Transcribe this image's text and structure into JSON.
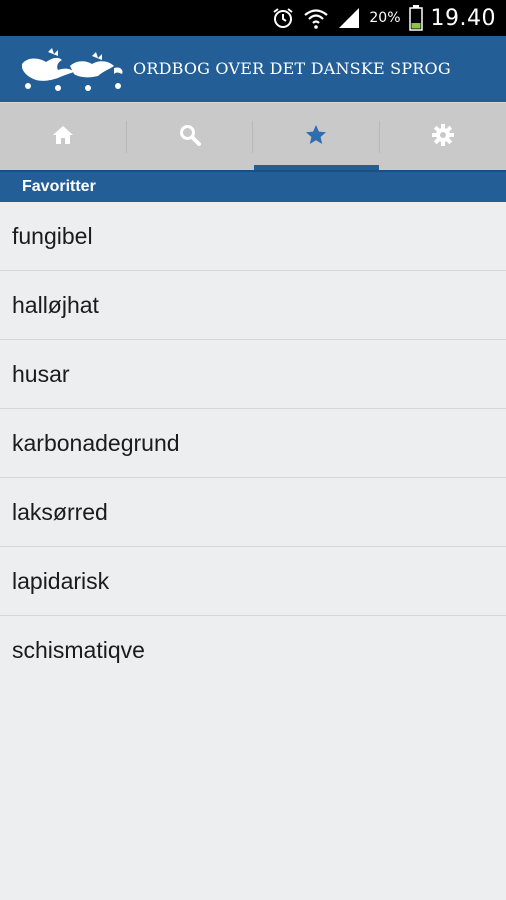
{
  "statusbar": {
    "battery_percent": "20%",
    "time": "19.40",
    "icons": [
      "alarm-icon",
      "wifi-icon",
      "signal-icon",
      "battery-icon"
    ]
  },
  "header": {
    "title": "ORDBOG OVER DET DANSKE SPROG",
    "logo": "danish-lions-logo",
    "color": "#235e97"
  },
  "tabs": [
    {
      "icon": "home-icon",
      "active": false
    },
    {
      "icon": "search-icon",
      "active": false
    },
    {
      "icon": "star-icon",
      "active": true
    },
    {
      "icon": "gear-icon",
      "active": false
    }
  ],
  "section": {
    "title": "Favoritter"
  },
  "favorites": [
    "fungibel",
    "halløjhat",
    "husar",
    "karbonadegrund",
    "laksørred",
    "lapidarisk",
    "schismatiqve"
  ],
  "colors": {
    "accent": "#235e97",
    "tab_active_icon": "#2f6db1",
    "tab_inactive_icon": "#ffffff",
    "background": "#edeef0"
  }
}
